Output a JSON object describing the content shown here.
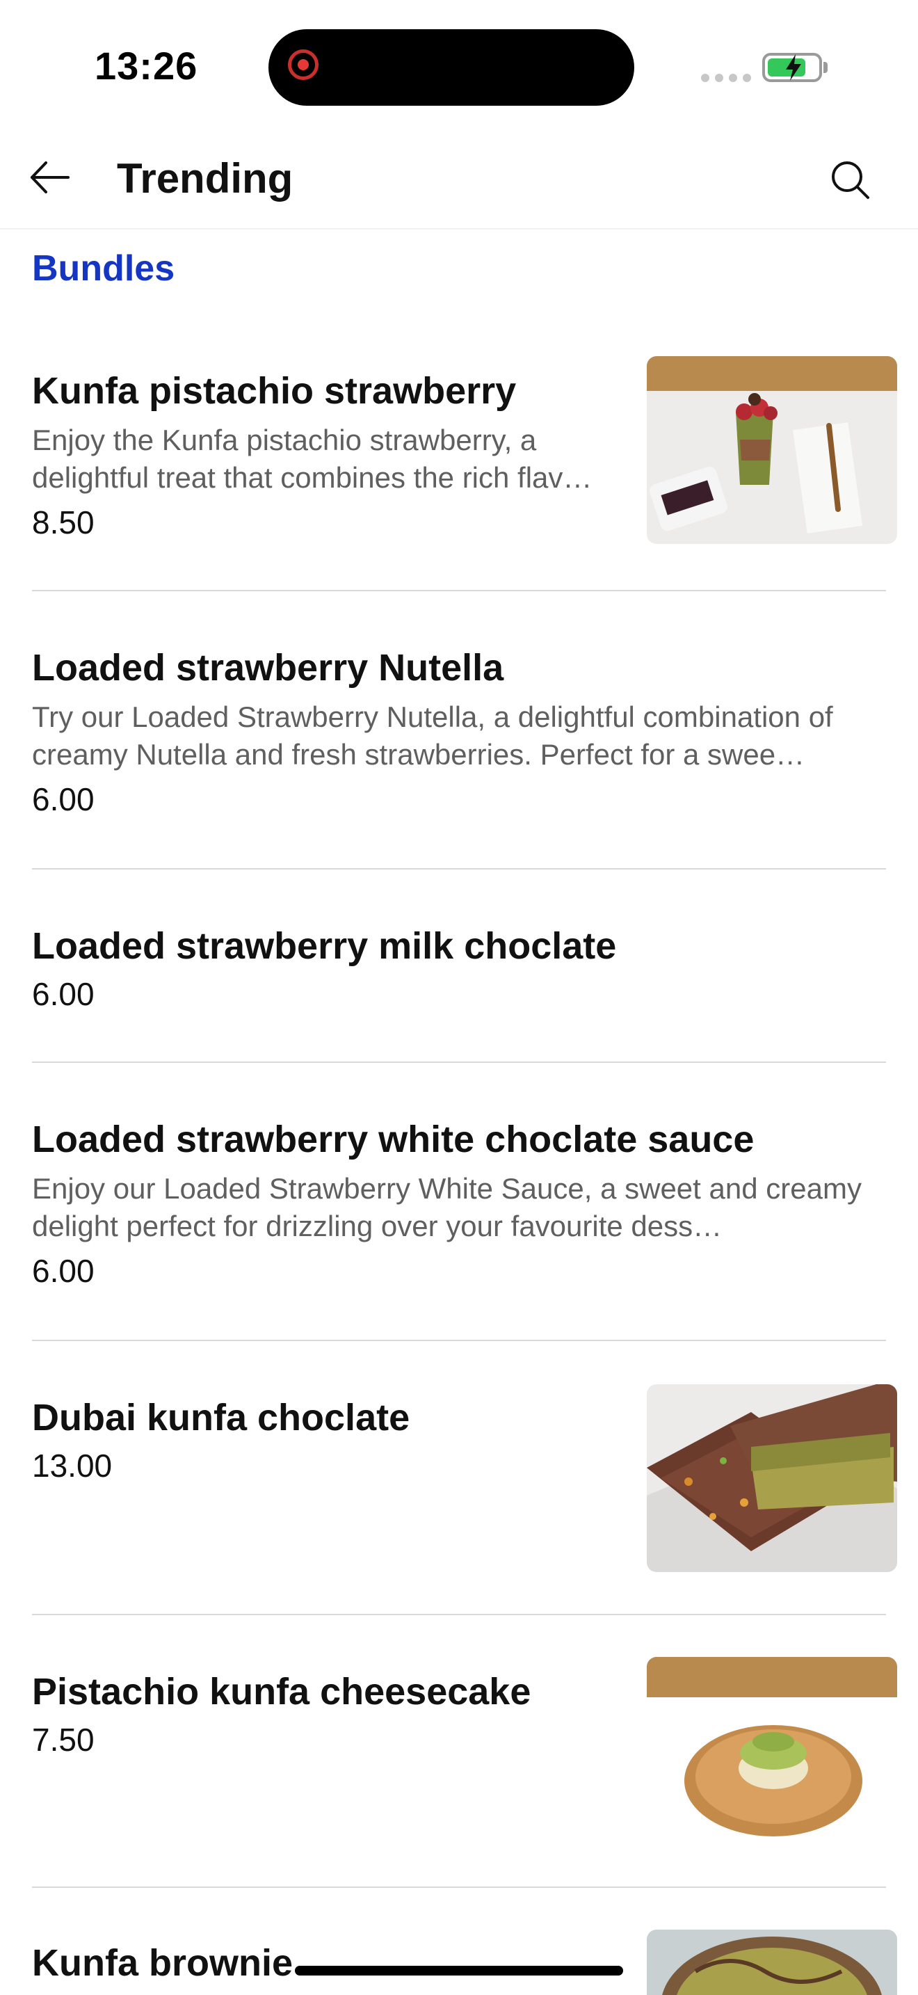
{
  "status_bar": {
    "time": "13:26"
  },
  "header": {
    "title": "Trending",
    "back_icon": "arrow-left-icon",
    "search_icon": "search-icon"
  },
  "section": {
    "title": "Bundles",
    "accent_color": "#1536c3"
  },
  "items": [
    {
      "name": "Kunfa pistachio strawberry",
      "description": "Enjoy the Kunfa pistachio strawberry, a delightful treat that combines the rich flav…",
      "price": "8.50",
      "has_image": true
    },
    {
      "name": "Loaded strawberry Nutella",
      "description": "Try our Loaded Strawberry Nutella, a delightful combination of creamy Nutella and fresh strawberries. Perfect for a swee…",
      "price": "6.00",
      "has_image": false
    },
    {
      "name": "Loaded strawberry milk choclate",
      "description": "",
      "price": "6.00",
      "has_image": false
    },
    {
      "name": "Loaded strawberry white choclate sauce",
      "description": "Enjoy our Loaded Strawberry White Sauce, a sweet and creamy delight perfect for drizzling over your favourite dess…",
      "price": "6.00",
      "has_image": false
    },
    {
      "name": "Dubai kunfa choclate",
      "description": "",
      "price": "13.00",
      "has_image": true
    },
    {
      "name": "Pistachio kunfa cheesecake",
      "description": "",
      "price": "7.50",
      "has_image": true
    },
    {
      "name": "Kunfa brownie",
      "description": "",
      "price": "",
      "has_image": true
    }
  ]
}
